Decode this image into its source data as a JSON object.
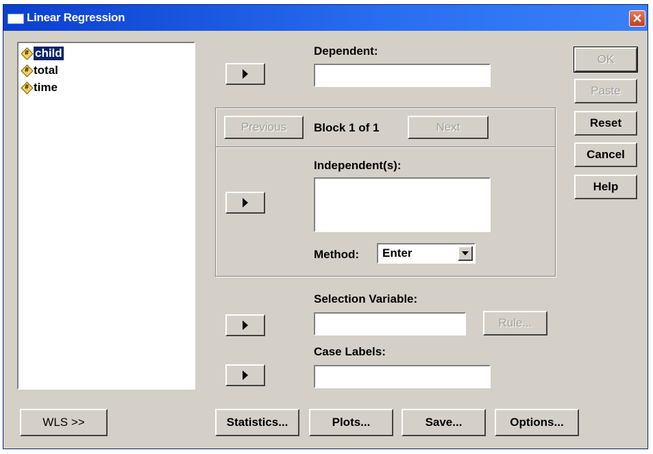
{
  "window": {
    "title": "Linear Regression",
    "close_glyph": "✕"
  },
  "variables": [
    {
      "label": "child",
      "selected": true
    },
    {
      "label": "total",
      "selected": false
    },
    {
      "label": "time",
      "selected": false
    }
  ],
  "dependent": {
    "label": "Dependent:",
    "value": ""
  },
  "block": {
    "previous": "Previous",
    "text": "Block 1 of 1",
    "next": "Next"
  },
  "independents": {
    "label": "Independent(s):",
    "value": ""
  },
  "method": {
    "label": "Method:",
    "value": "Enter"
  },
  "selection": {
    "label": "Selection Variable:",
    "value": "",
    "rule": "Rule..."
  },
  "case_labels": {
    "label": "Case Labels:",
    "value": ""
  },
  "side_buttons": {
    "ok": "OK",
    "paste": "Paste",
    "reset": "Reset",
    "cancel": "Cancel",
    "help": "Help"
  },
  "bottom_buttons": {
    "wls": "WLS >>",
    "statistics": "Statistics...",
    "plots": "Plots...",
    "save": "Save...",
    "options": "Options..."
  }
}
